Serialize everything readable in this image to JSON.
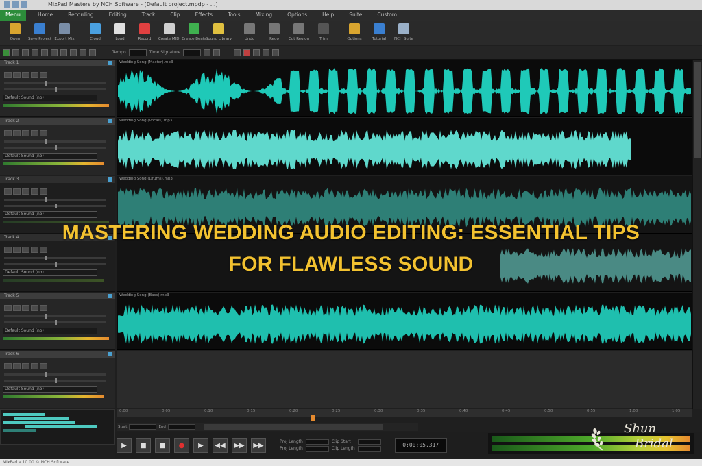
{
  "window": {
    "title": "MixPad Masters by NCH Software - [Default project.mpdp - ...]"
  },
  "menu": {
    "main": "Menu",
    "items": [
      "Home",
      "Recording",
      "Editing",
      "Track",
      "Clip",
      "Effects",
      "Tools",
      "Mixing",
      "Options",
      "Help",
      "Suite",
      "Custom"
    ]
  },
  "toolbar": {
    "buttons": [
      {
        "label": "Open",
        "icon": "folder-icon",
        "color": "#d9a52f"
      },
      {
        "label": "Save Project",
        "icon": "save-icon",
        "color": "#3a7fd0"
      },
      {
        "label": "Export Mix",
        "icon": "export-icon",
        "color": "#7a8ea8"
      },
      {
        "label": "Cloud",
        "icon": "cloud-icon",
        "color": "#4aa0e0"
      },
      {
        "label": "Load",
        "icon": "load-icon",
        "color": "#e0e0e0"
      },
      {
        "label": "Record",
        "icon": "record-icon",
        "color": "#e04040"
      },
      {
        "label": "Create MIDI",
        "icon": "midi-icon",
        "color": "#cfcfcf"
      },
      {
        "label": "Create Beats",
        "icon": "beats-icon",
        "color": "#3fb04f"
      },
      {
        "label": "Sound Library",
        "icon": "library-icon",
        "color": "#e0c040"
      },
      {
        "label": "Undo",
        "icon": "undo-icon",
        "color": "#777777"
      },
      {
        "label": "Redo",
        "icon": "redo-icon",
        "color": "#777777"
      },
      {
        "label": "Cut Region",
        "icon": "cut-icon",
        "color": "#777777"
      },
      {
        "label": "Trim",
        "icon": "trim-icon",
        "color": "#555555"
      },
      {
        "label": "Options",
        "icon": "options-icon",
        "color": "#d9a52f"
      },
      {
        "label": "Tutorial",
        "icon": "tutorial-icon",
        "color": "#3a7fd0"
      },
      {
        "label": "NCH Suite",
        "icon": "suite-icon",
        "color": "#9ab0c8"
      }
    ]
  },
  "subbar": {
    "tempo_label": "Tempo",
    "time_signature_label": "Time Signature"
  },
  "tracks": [
    {
      "name": "Track 1",
      "effect": "Default Sound (no)",
      "clip": "Wedding Song (Master).mp3",
      "color": "#1fc9b8"
    },
    {
      "name": "Track 2",
      "effect": "Default Sound (no)",
      "clip": "Wedding Song (Vocals).mp3",
      "color": "#5fd8cc"
    },
    {
      "name": "Track 3",
      "effect": "Default Sound (no)",
      "clip": "Wedding Song (Drums).mp3",
      "color": "#2e7f76"
    },
    {
      "name": "Track 4",
      "effect": "Default Sound (no)",
      "clip": "",
      "color": "#4a8a84"
    },
    {
      "name": "Track 5",
      "effect": "Default Sound (no)",
      "clip": "Wedding Song (Bass).mp3",
      "color": "#1fbfae"
    },
    {
      "name": "Track 6",
      "effect": "Default Sound (no)",
      "clip": "",
      "color": "#2b2b2b"
    }
  ],
  "timeline": {
    "ticks": [
      "0:00",
      "0:05",
      "0:10",
      "0:15",
      "0:20",
      "0:25",
      "0:30",
      "0:35",
      "0:40",
      "0:45",
      "0:50",
      "0:55",
      "1:00",
      "1:05"
    ]
  },
  "transport": {
    "start_label": "Start",
    "end_label": "End",
    "time": "0:00:05.317",
    "info_labels": [
      "Proj Length",
      "Clip Start",
      "Proj Length",
      "Clip Length"
    ]
  },
  "statusbar": {
    "text": "MixPad v 10.00 © NCH Software"
  },
  "overlay": {
    "headline_line1": "MASTERING WEDDING AUDIO EDITING: ESSENTIAL TIPS",
    "headline_line2": "FOR FLAWLESS SOUND"
  },
  "watermark": {
    "line1": "Shun",
    "line2": "Bridal"
  },
  "colors": {
    "accent": "#f3c230",
    "waveform": "#1fc9b8",
    "menu_active": "#2c8c3a"
  }
}
